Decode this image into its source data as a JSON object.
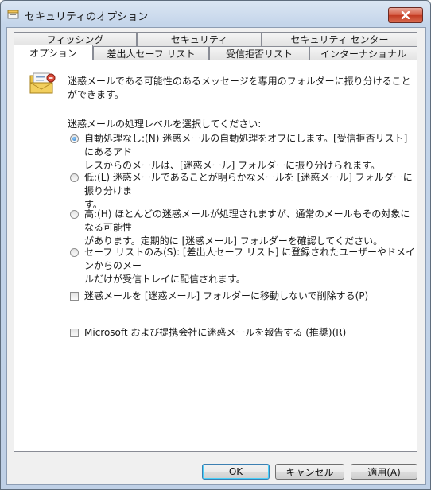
{
  "window": {
    "title": "セキュリティのオプション"
  },
  "tabs": {
    "row_back": [
      "フィッシング",
      "セキュリティ",
      "セキュリティ センター"
    ],
    "row_front": [
      "オプション",
      "差出人セーフ リスト",
      "受信拒否リスト",
      "インターナショナル"
    ],
    "active": "オプション"
  },
  "options": {
    "description": "迷惑メールである可能性のあるメッセージを専用のフォルダーに振り分けることができます。",
    "level_heading": "迷惑メールの処理レベルを選択してください:",
    "levels": [
      {
        "lines": [
          "自動処理なし:(N) 迷惑メールの自動処理をオフにします。[受信拒否リスト] にあるアド",
          "レスからのメールは、[迷惑メール] フォルダーに振り分けられます。"
        ],
        "checked": true
      },
      {
        "lines": [
          "低:(L) 迷惑メールであることが明らかなメールを [迷惑メール] フォルダーに振り分けま",
          "す。"
        ],
        "checked": false
      },
      {
        "lines": [
          "高:(H) ほとんどの迷惑メールが処理されますが、通常のメールもその対象になる可能性",
          "があります。定期的に [迷惑メール] フォルダーを確認してください。"
        ],
        "checked": false
      },
      {
        "lines": [
          "セーフ リストのみ(S): [差出人セーフ リスト] に登録されたユーザーやドメインからのメー",
          "ルだけが受信トレイに配信されます。"
        ],
        "checked": false
      }
    ],
    "delete_checkbox": {
      "label": "迷惑メールを [迷惑メール] フォルダーに移動しないで削除する(P)",
      "checked": false
    },
    "report_checkbox": {
      "label": "Microsoft および提携会社に迷惑メールを報告する (推奨)(R)",
      "checked": false
    }
  },
  "buttons": {
    "ok": "OK",
    "cancel": "キャンセル",
    "apply": "適用(A)"
  },
  "icons": {
    "app": "app-window-icon",
    "close": "close-icon",
    "junk": "junk-mail-icon"
  }
}
